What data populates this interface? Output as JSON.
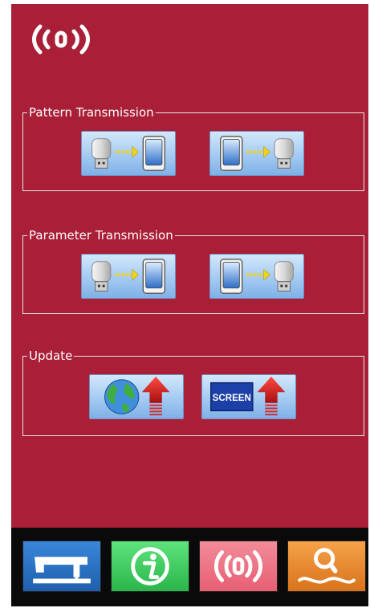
{
  "header": {
    "icon": "wireless-signal-icon"
  },
  "groups": {
    "pattern": {
      "title": "Pattern Transmission",
      "buttons": [
        {
          "icon": "usb-to-panel-icon"
        },
        {
          "icon": "panel-to-usb-icon"
        }
      ]
    },
    "parameter": {
      "title": "Parameter Transmission",
      "buttons": [
        {
          "icon": "usb-to-panel-icon"
        },
        {
          "icon": "panel-to-usb-icon"
        }
      ]
    },
    "update": {
      "title": "Update",
      "buttons": [
        {
          "icon": "globe-upload-icon"
        },
        {
          "icon": "screen-upload-icon",
          "text": "SCREEN"
        }
      ]
    }
  },
  "nav": [
    {
      "icon": "sewing-machine-icon",
      "color": "#2b74c7"
    },
    {
      "icon": "info-icon",
      "color": "#3cc75a"
    },
    {
      "icon": "wireless-signal-icon",
      "color": "#ea6f82"
    },
    {
      "icon": "pattern-search-icon",
      "color": "#e98a2c"
    }
  ],
  "colors": {
    "background": "#a91f37",
    "button": "#a8cdf3",
    "arrow": "#f1d21a"
  }
}
